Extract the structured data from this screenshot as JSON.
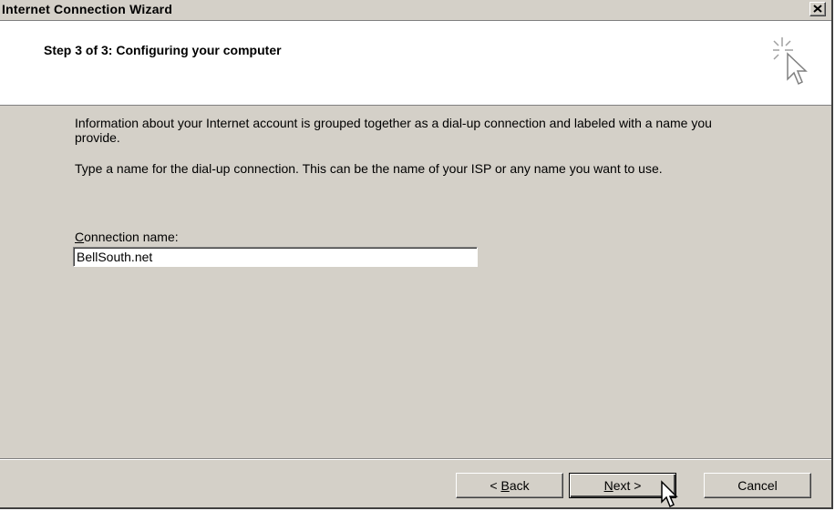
{
  "window": {
    "title": "Internet Connection Wizard"
  },
  "header": {
    "title": "Step 3 of 3: Configuring your computer",
    "icon": "wizard-sparkle-cursor-icon"
  },
  "body": {
    "paragraph1": "Information about your Internet account is grouped together as a dial-up connection and labeled with a name you provide.",
    "paragraph2": "Type a name for the dial-up connection. This can be the name of your ISP or any name you want to use.",
    "connection_label_mnemonic": "C",
    "connection_label_rest": "onnection name:",
    "connection_name_value": "BellSouth.net"
  },
  "buttons": {
    "back_prefix": "< ",
    "back_mnemonic": "B",
    "back_rest": "ack",
    "next_mnemonic": "N",
    "next_rest": "ext >",
    "cancel": "Cancel"
  }
}
